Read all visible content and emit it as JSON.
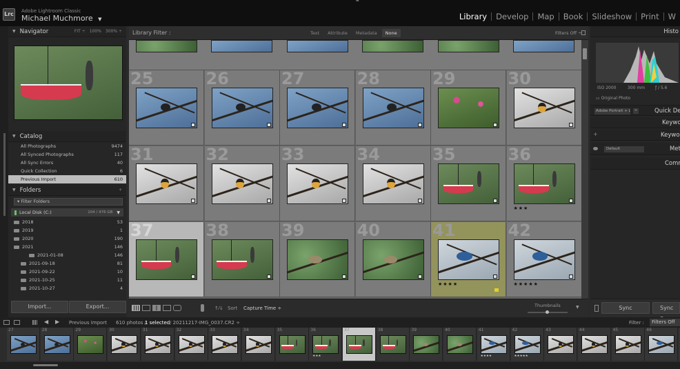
{
  "app": {
    "logo": "Lrc",
    "brand": "Adobe Lightroom Classic",
    "user": "Michael Muchmore",
    "user_caret": "▼",
    "top_arrow": "▲"
  },
  "modules": [
    "Library",
    "Develop",
    "Map",
    "Book",
    "Slideshow",
    "Print",
    "W"
  ],
  "active_module": "Library",
  "navigator": {
    "title": "Navigator",
    "zoom": [
      "FIT ÷",
      "100%",
      "300% ÷"
    ]
  },
  "catalog": {
    "title": "Catalog",
    "items": [
      {
        "label": "All Photographs",
        "count": "9474"
      },
      {
        "label": "All Synced Photographs",
        "count": "117"
      },
      {
        "label": "All Sync Errors",
        "count": "40"
      },
      {
        "label": "Quick Collection",
        "count": "6"
      },
      {
        "label": "Previous Import",
        "count": "610"
      }
    ]
  },
  "folders": {
    "title": "Folders",
    "filter": "Filter Folders",
    "disk": "Local Disk (C:)",
    "disk_size": "104 / 476 GB",
    "items": [
      {
        "label": "2018",
        "count": "53"
      },
      {
        "label": "2019",
        "count": "1"
      },
      {
        "label": "2020",
        "count": "190"
      },
      {
        "label": "2021",
        "count": "146"
      },
      {
        "label": "2021-01-08",
        "count": "146"
      },
      {
        "label": "2021-09-18",
        "count": "81"
      },
      {
        "label": "2021-09-22",
        "count": "10"
      },
      {
        "label": "2021-10-25",
        "count": "11"
      },
      {
        "label": "2021-10-27",
        "count": "4"
      }
    ]
  },
  "buttons": {
    "import": "Import...",
    "export": "Export..."
  },
  "filter": {
    "title": "Library Filter :",
    "tabs": [
      "Text",
      "Attribute",
      "Metadata",
      "None"
    ],
    "active": "None",
    "status": "Filters Off ÷"
  },
  "grid": {
    "cells": [
      {
        "num": "25",
        "img": "blue",
        "bird": "branch"
      },
      {
        "num": "26",
        "img": "blue",
        "bird": "branch"
      },
      {
        "num": "27",
        "img": "blue",
        "bird": "branch"
      },
      {
        "num": "28",
        "img": "blue",
        "bird": "branch"
      },
      {
        "num": "29",
        "img": "flower",
        "bird": "none"
      },
      {
        "num": "30",
        "img": "grey",
        "bird": "oriole"
      },
      {
        "num": "31",
        "img": "grey",
        "bird": "oriole"
      },
      {
        "num": "32",
        "img": "grey",
        "bird": "oriole"
      },
      {
        "num": "33",
        "img": "grey",
        "bird": "oriole"
      },
      {
        "num": "34",
        "img": "grey",
        "bird": "oriole"
      },
      {
        "num": "35",
        "img": "feed",
        "bird": "feeder"
      },
      {
        "num": "36",
        "img": "feed",
        "bird": "feeder",
        "stars": "★★★"
      },
      {
        "num": "37",
        "img": "feed",
        "bird": "feeder",
        "selected": true
      },
      {
        "num": "38",
        "img": "feed",
        "bird": "feeder"
      },
      {
        "num": "39",
        "img": "green",
        "bird": "grey"
      },
      {
        "num": "40",
        "img": "green",
        "bird": "grey"
      },
      {
        "num": "41",
        "img": "sky",
        "bird": "jay",
        "stars": "★★★★",
        "flag": true
      },
      {
        "num": "42",
        "img": "sky",
        "bird": "jay",
        "stars": "★★★★★"
      }
    ]
  },
  "toolbar": {
    "sort_label": "Sort",
    "sort_value": "Capture Time ÷",
    "thumbs_label": "Thumbnails",
    "sort_icon": "↑⁄↓"
  },
  "right": {
    "histogram_title": "Histo",
    "iso": "ISO 2000",
    "focal": "300 mm",
    "aperture": "ƒ / 5.6",
    "original": "Original Photo",
    "preset": "Adobe Portrait + L...",
    "quick_dev": "Quick De",
    "keyword1": "Keywo",
    "keyword2": "Keywor",
    "meta_preset": "Default",
    "metadata": "Met",
    "comments": "Comm",
    "sync": "Sync",
    "sync_settings": "Sync Se"
  },
  "filmbar": {
    "source": "Previous Import",
    "count": "610 photos /",
    "selected": "1 selected",
    "path": "/ 20211217-IMG_0037.CR2 ÷",
    "filter_label": "Filter :",
    "filter_value": "Filters Off"
  },
  "filmstrip": {
    "cells": [
      {
        "num": "27",
        "img": "blue"
      },
      {
        "num": "28",
        "img": "blue"
      },
      {
        "num": "29",
        "img": "flower"
      },
      {
        "num": "30",
        "img": "grey"
      },
      {
        "num": "31",
        "img": "grey"
      },
      {
        "num": "32",
        "img": "grey"
      },
      {
        "num": "33",
        "img": "grey"
      },
      {
        "num": "34",
        "img": "grey"
      },
      {
        "num": "35",
        "img": "feed"
      },
      {
        "num": "36",
        "img": "feed",
        "stars": "★★★"
      },
      {
        "num": "37",
        "img": "feed",
        "selected": true
      },
      {
        "num": "38",
        "img": "feed"
      },
      {
        "num": "39",
        "img": "green"
      },
      {
        "num": "40",
        "img": "green"
      },
      {
        "num": "41",
        "img": "sky",
        "stars": "★★★★"
      },
      {
        "num": "42",
        "img": "sky",
        "stars": "★★★★★"
      },
      {
        "num": "43",
        "img": "grey"
      },
      {
        "num": "44",
        "img": "grey"
      },
      {
        "num": "45",
        "img": "grey"
      },
      {
        "num": "46",
        "img": "sky"
      },
      {
        "num": "47",
        "img": "grey"
      }
    ]
  }
}
